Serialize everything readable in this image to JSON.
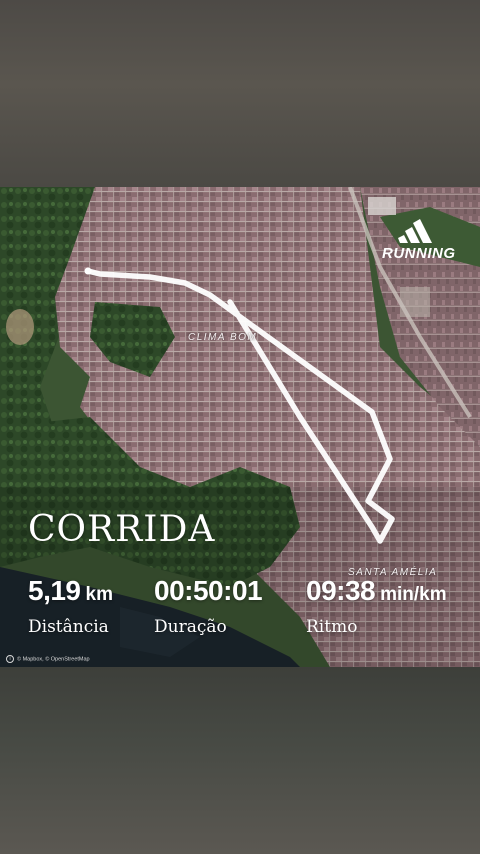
{
  "brand": {
    "logo_icon": "adidas-stripes-icon",
    "label": "RUNNING"
  },
  "map": {
    "places": [
      "CLIMA BOM",
      "SANTA AMÉLIA"
    ],
    "attribution": "© Mapbox, © OpenStreetMap",
    "colors": {
      "route": "#ffffff",
      "urban": "#8a6f73",
      "forest": "#2f4a2a",
      "water": "#1f2a33"
    }
  },
  "activity": {
    "title": "CORRIDA",
    "distance": {
      "value": "5,19",
      "unit": "km",
      "label": "Distância"
    },
    "duration": {
      "value": "00:50:01",
      "label": "Duração"
    },
    "pace": {
      "value": "09:38",
      "unit": "min/km",
      "label": "Ritmo"
    }
  }
}
